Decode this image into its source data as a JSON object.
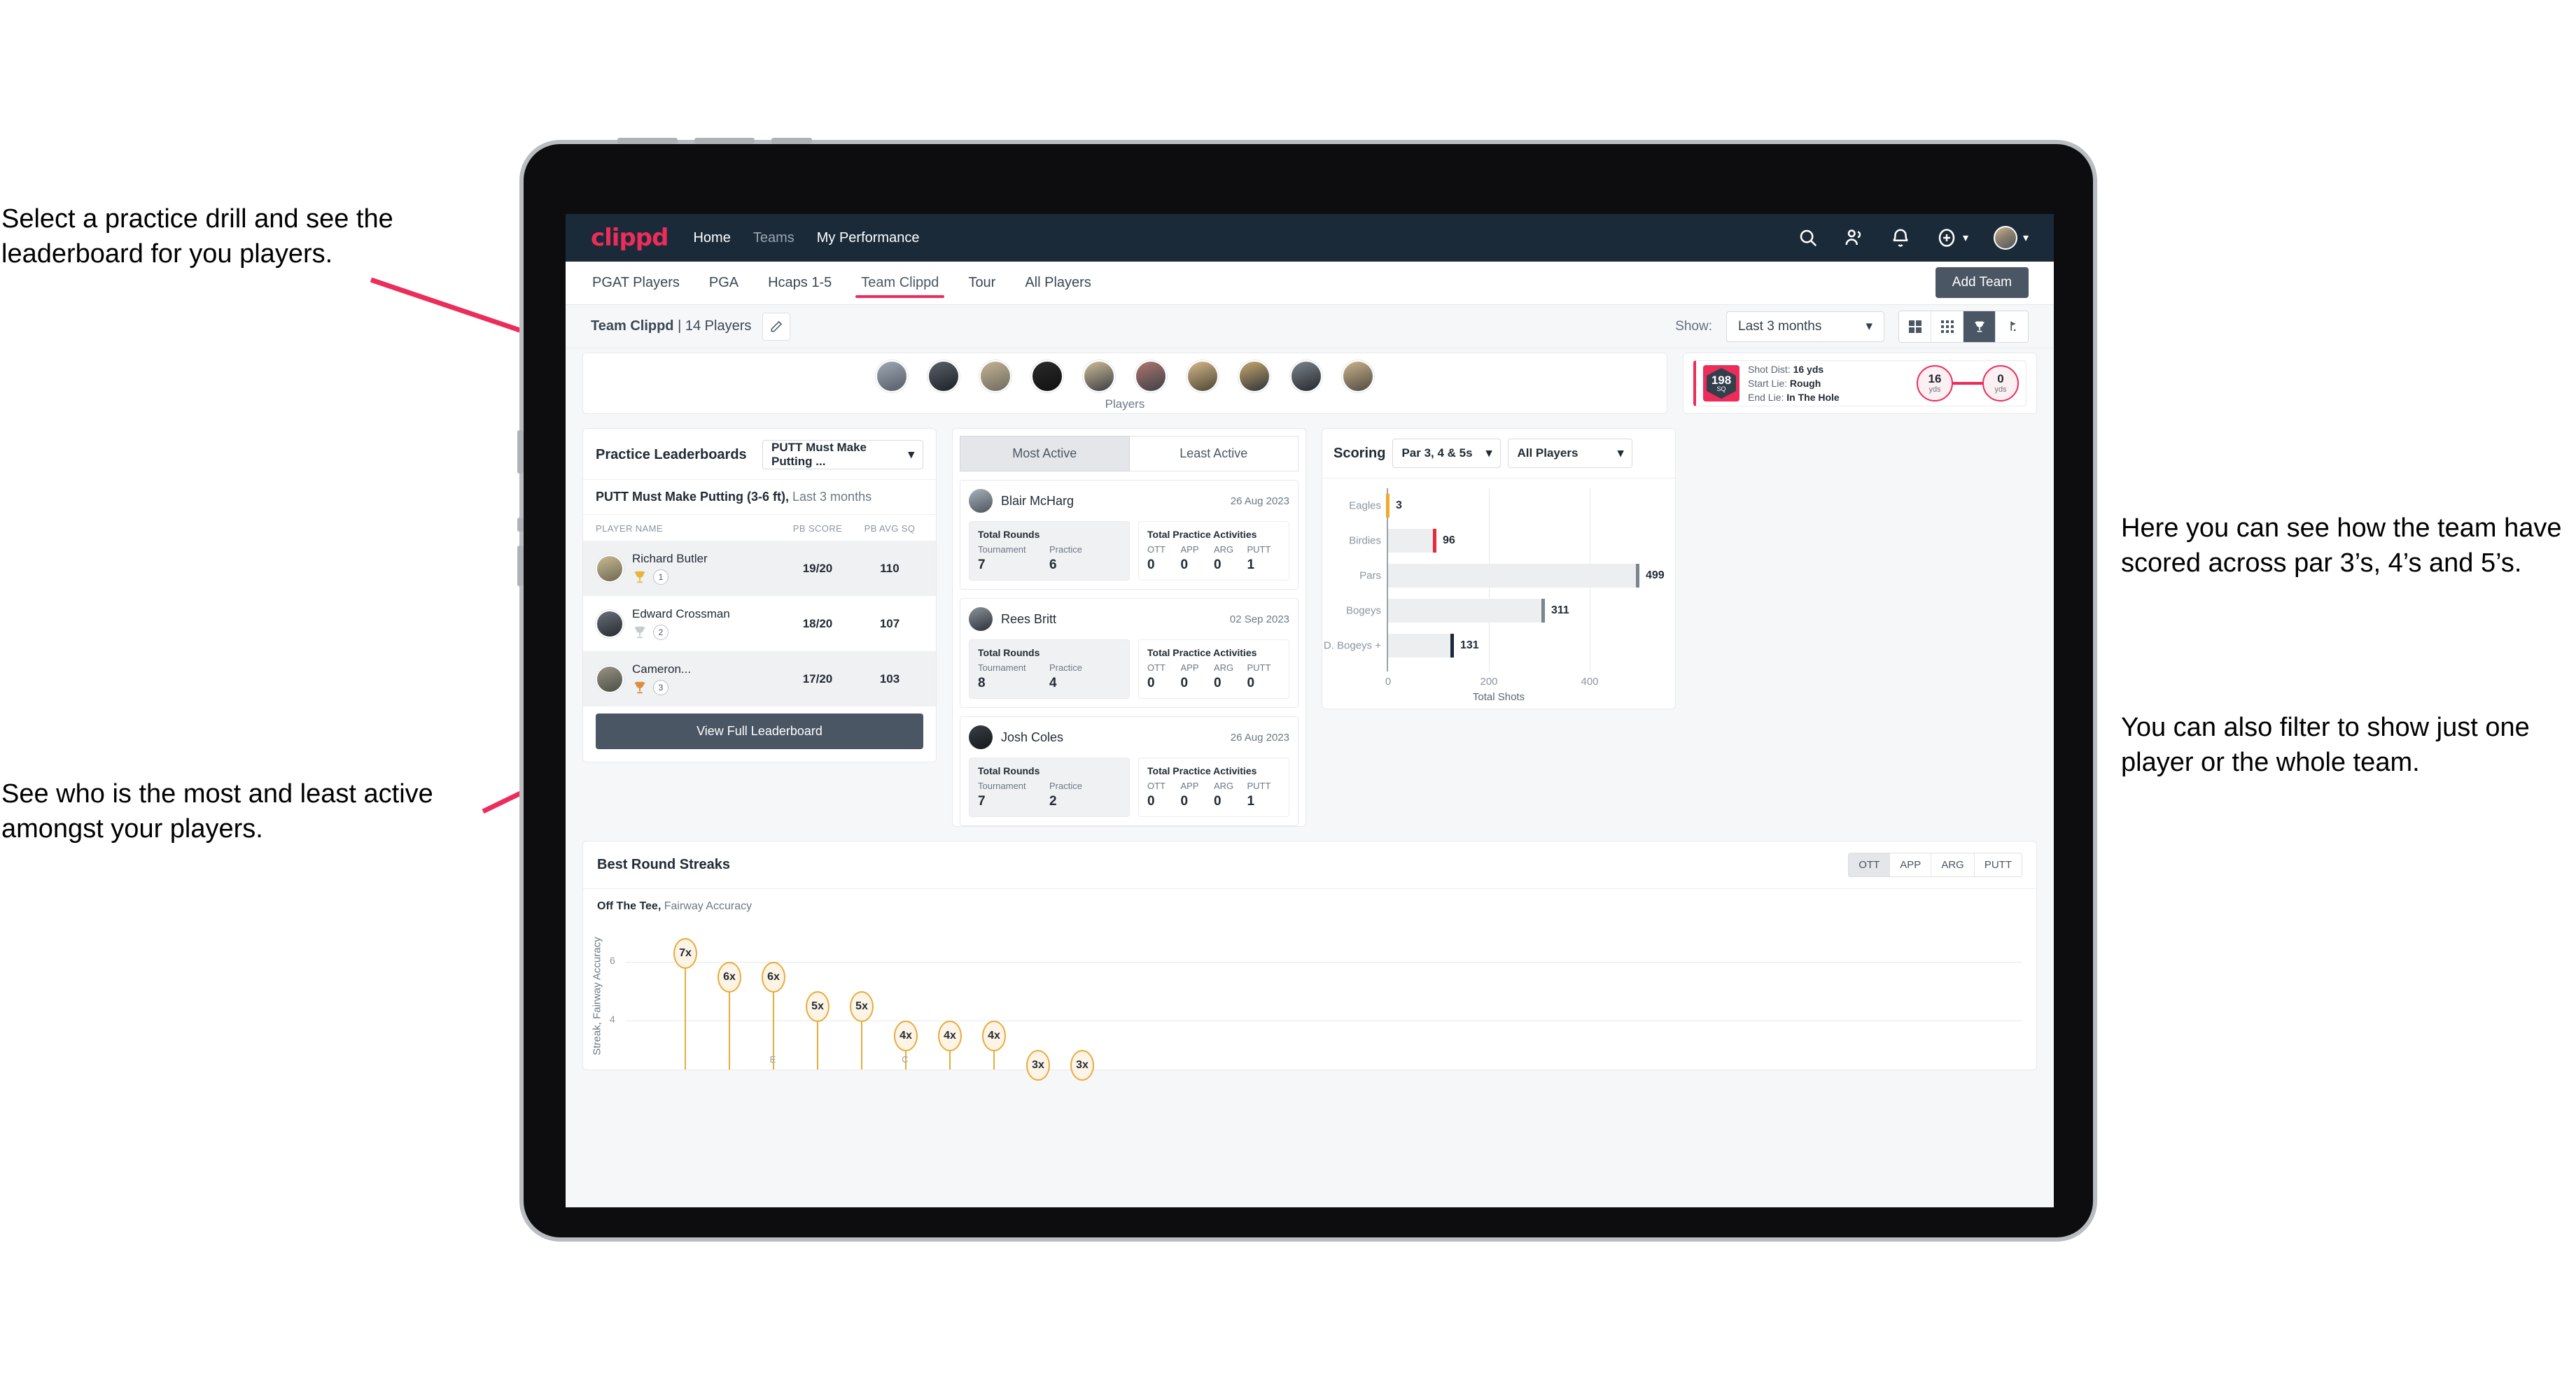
{
  "annotations": [
    "Select a practice drill and see the leaderboard for you players.",
    "See who is the most and least active amongst your players.",
    "Here you can see how the team have scored across par 3’s, 4’s and 5’s.",
    "You can also filter to show just one player or the whole team."
  ],
  "topbar": {
    "logo": "clippd",
    "links": [
      {
        "label": "Home",
        "active": true
      },
      {
        "label": "Teams",
        "active": false
      },
      {
        "label": "My Performance",
        "active": true
      }
    ],
    "icons": [
      "search-icon",
      "people-icon",
      "bell-icon",
      "plus-circle-icon",
      "avatar"
    ]
  },
  "tabs": [
    {
      "label": "PGAT Players",
      "active": false
    },
    {
      "label": "PGA",
      "active": false
    },
    {
      "label": "Hcaps 1-5",
      "active": false
    },
    {
      "label": "Team Clippd",
      "active": true
    },
    {
      "label": "Tour",
      "active": false
    },
    {
      "label": "All Players",
      "active": false
    }
  ],
  "add_team_label": "Add Team",
  "subbar": {
    "team_name": "Team Clippd",
    "team_separator": "|",
    "player_count": "14 Players",
    "edit_icon": "pencil-icon",
    "show_label": "Show:",
    "range_value": "Last 3 months",
    "views": [
      {
        "name": "grid-large-view",
        "active": false
      },
      {
        "name": "grid-small-view",
        "active": false
      },
      {
        "name": "trophy-view",
        "active": true
      },
      {
        "name": "golf-flag-view",
        "active": false
      }
    ]
  },
  "players_card": {
    "caption": "Players",
    "count": 10
  },
  "shot_card": {
    "sq_value": "198",
    "sq_unit": "SQ",
    "lines": [
      {
        "k": "Shot Dist:",
        "v": "16 yds"
      },
      {
        "k": "Start Lie:",
        "v": "Rough"
      },
      {
        "k": "End Lie:",
        "v": "In The Hole"
      }
    ],
    "start_value": "16",
    "start_unit": "yds",
    "end_value": "0",
    "end_unit": "yds"
  },
  "leaderboard": {
    "title": "Practice Leaderboards",
    "drill_select": "PUTT Must Make Putting ...",
    "subtitle_bold": "PUTT Must Make Putting (3-6 ft),",
    "subtitle_rest": "Last 3 months",
    "columns": [
      "PLAYER NAME",
      "PB SCORE",
      "PB AVG SQ"
    ],
    "rows": [
      {
        "name": "Richard Butler",
        "rank": "1",
        "trophy": "gold",
        "score": "19/20",
        "sq": "110"
      },
      {
        "name": "Edward Crossman",
        "rank": "2",
        "trophy": "silver",
        "score": "18/20",
        "sq": "107"
      },
      {
        "name": "Cameron...",
        "rank": "3",
        "trophy": "bronze",
        "score": "17/20",
        "sq": "103"
      }
    ],
    "button": "View Full Leaderboard"
  },
  "activity": {
    "tabs": [
      {
        "label": "Most Active",
        "active": true
      },
      {
        "label": "Least Active",
        "active": false
      }
    ],
    "rounds_title": "Total Rounds",
    "activities_title": "Total Practice Activities",
    "rounds_cols": [
      "Tournament",
      "Practice"
    ],
    "activity_cols": [
      "OTT",
      "APP",
      "ARG",
      "PUTT"
    ],
    "items": [
      {
        "name": "Blair McHarg",
        "date": "26 Aug 2023",
        "tournament": "7",
        "practice": "6",
        "ott": "0",
        "app": "0",
        "arg": "0",
        "putt": "1"
      },
      {
        "name": "Rees Britt",
        "date": "02 Sep 2023",
        "tournament": "8",
        "practice": "4",
        "ott": "0",
        "app": "0",
        "arg": "0",
        "putt": "0"
      },
      {
        "name": "Josh Coles",
        "date": "26 Aug 2023",
        "tournament": "7",
        "practice": "2",
        "ott": "0",
        "app": "0",
        "arg": "0",
        "putt": "1"
      }
    ]
  },
  "scoring": {
    "title": "Scoring",
    "par_filter": "Par 3, 4 & 5s",
    "player_filter": "All Players"
  },
  "streaks": {
    "title": "Best Round Streaks",
    "segments": [
      {
        "label": "OTT",
        "active": true
      },
      {
        "label": "APP",
        "active": false
      },
      {
        "label": "ARG",
        "active": false
      },
      {
        "label": "PUTT",
        "active": false
      }
    ],
    "sub_bold": "Off The Tee,",
    "sub_rest": "Fairway Accuracy",
    "ylabel": "Streak, Fairway Accuracy"
  },
  "chart_data": [
    {
      "type": "bar",
      "title": "Scoring",
      "orientation": "horizontal",
      "categories": [
        "Eagles",
        "Birdies",
        "Pars",
        "Bogeys",
        "D. Bogeys +"
      ],
      "values": [
        3,
        96,
        499,
        311,
        131
      ],
      "cap_colors": [
        "#f0a830",
        "#e8283f",
        "#7c858e",
        "#7c858e",
        "#1b2a38"
      ],
      "xlabel": "Total Shots",
      "ylabel": "",
      "xlim": [
        0,
        540
      ],
      "xticks": [
        0,
        200,
        400
      ],
      "grid": true,
      "legend": "none"
    },
    {
      "type": "scatter",
      "title": "Best Round Streaks — Off The Tee, Fairway Accuracy",
      "xlabel": "",
      "ylabel": "Streak, Fairway Accuracy",
      "ylim": [
        2,
        8
      ],
      "yticks": [
        4,
        6
      ],
      "grid": true,
      "labels": [
        "7x",
        "6x",
        "6x",
        "5x",
        "5x",
        "4x",
        "4x",
        "4x",
        "3x",
        "3x"
      ],
      "values": [
        7,
        6,
        6,
        5,
        5,
        4,
        4,
        4,
        3,
        3
      ],
      "xtick_labels": [
        "E",
        "C"
      ],
      "legend": "none"
    }
  ],
  "colors": {
    "brand": "#ec2c5a",
    "navy": "#1b2a38",
    "slate": "#4a5663",
    "gold": "#e8ab3c"
  }
}
